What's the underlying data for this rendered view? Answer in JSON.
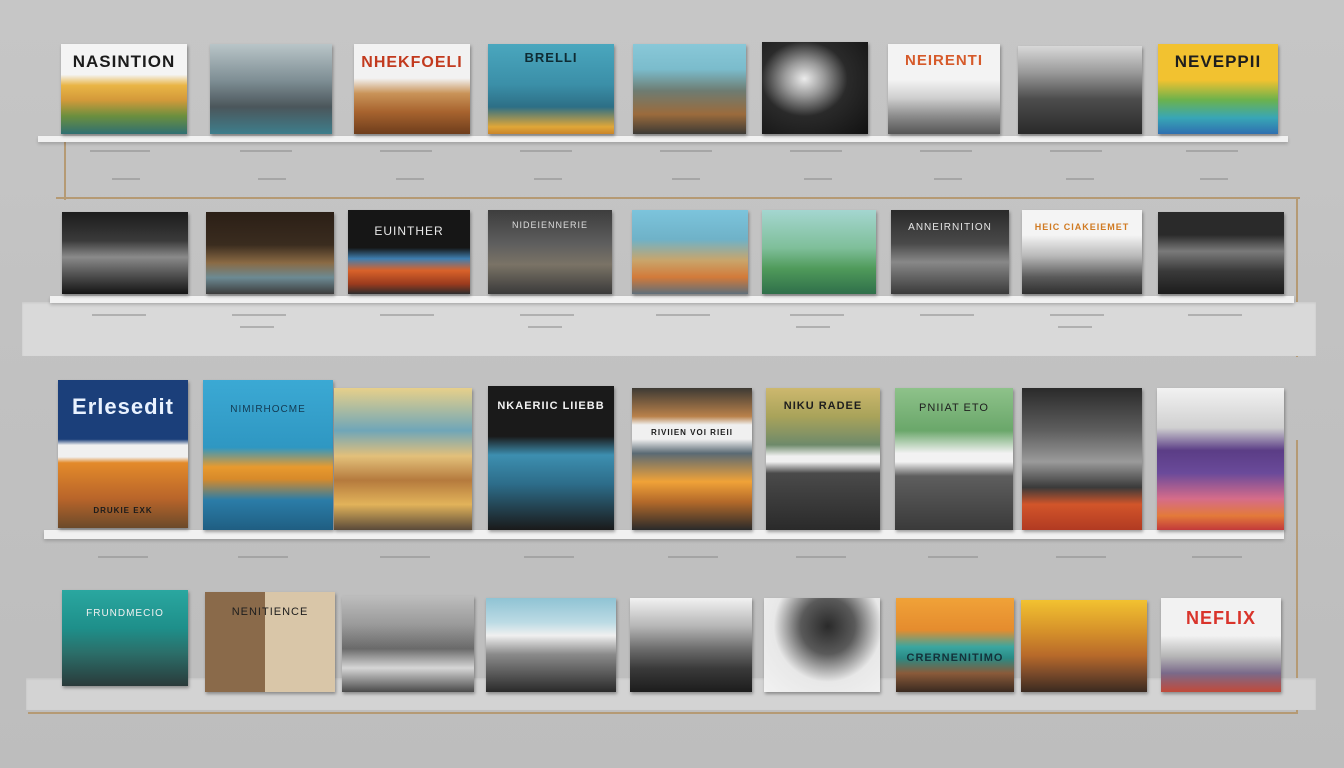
{
  "cards": {
    "r1c1": "NASINTION",
    "r1c3": "NHEKFOELI",
    "r1c4": "BRELLI",
    "r1c7": "NEIRENTI",
    "r1c9": "NEVEPPII",
    "r2c3": "EUINTHER",
    "r2c4": "NIDEIENNERIE",
    "r2c7": "ANNEIRNITION",
    "r2c8": "HEIC CIAKEIEMET",
    "r3c1": "Erlesedit",
    "r3c1b": "DRUKIE EXK",
    "r3c2": "NIMIRHOCME",
    "r3c4": "NKAERIIC LIIEBB",
    "r3c5": "RIVIIEN VOI RIEII",
    "r3c6": "NIKU RADEE",
    "r3c7": "PNIIAT ETO",
    "r4c1": "FRUNDMECIO",
    "r4c2": "NENITIENCE",
    "r4c7": "CRERNENITIMO",
    "r4c9": "NEFLIX"
  },
  "colors": {
    "accent_red": "#d9342b",
    "accent_yellow": "#f2c230",
    "accent_teal": "#3fb3c7",
    "shelf": "#f1f1f1",
    "rod": "#b59a74"
  }
}
